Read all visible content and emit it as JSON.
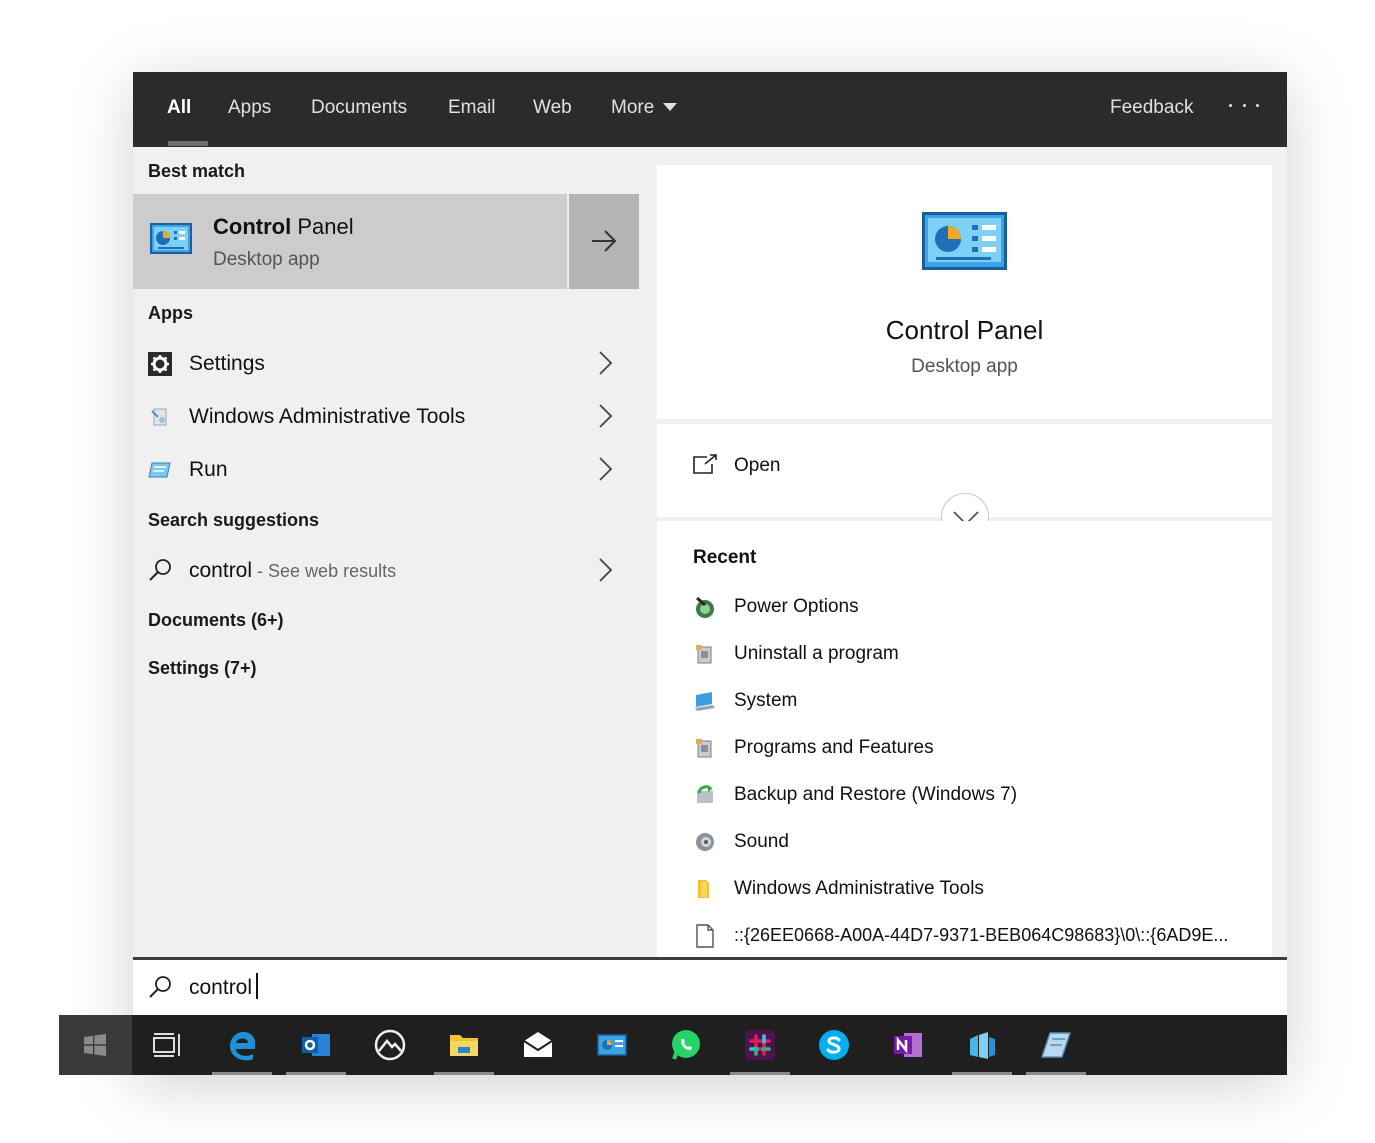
{
  "nav": {
    "tabs": [
      "All",
      "Apps",
      "Documents",
      "Email",
      "Web",
      "More"
    ],
    "feedback": "Feedback"
  },
  "left": {
    "best_match_heading": "Best match",
    "best": {
      "title_bold": "Control",
      "title_rest": " Panel",
      "subtitle": "Desktop app"
    },
    "apps_heading": "Apps",
    "apps": [
      "Settings",
      "Windows Administrative Tools",
      "Run"
    ],
    "suggestions_heading": "Search suggestions",
    "suggestion": {
      "term": "control",
      "hint": " - See web results"
    },
    "documents_heading": "Documents (6+)",
    "settings_heading": "Settings (7+)"
  },
  "right": {
    "title": "Control Panel",
    "subtitle": "Desktop app",
    "open_label": "Open",
    "recent_heading": "Recent",
    "recent": [
      "Power Options",
      "Uninstall a program",
      "System",
      "Programs and Features",
      "Backup and Restore (Windows 7)",
      "Sound",
      "Windows Administrative Tools",
      "::{26EE0668-A00A-44D7-9371-BEB064C98683}\\0\\::{6AD9E..."
    ]
  },
  "search": {
    "value": "control"
  },
  "colors": {
    "accent_blue": "#1f8fd8",
    "nav_bg": "#2b2b2b",
    "panel_bg": "#f0f0f0",
    "taskbar_bg": "#1f1f1f"
  }
}
